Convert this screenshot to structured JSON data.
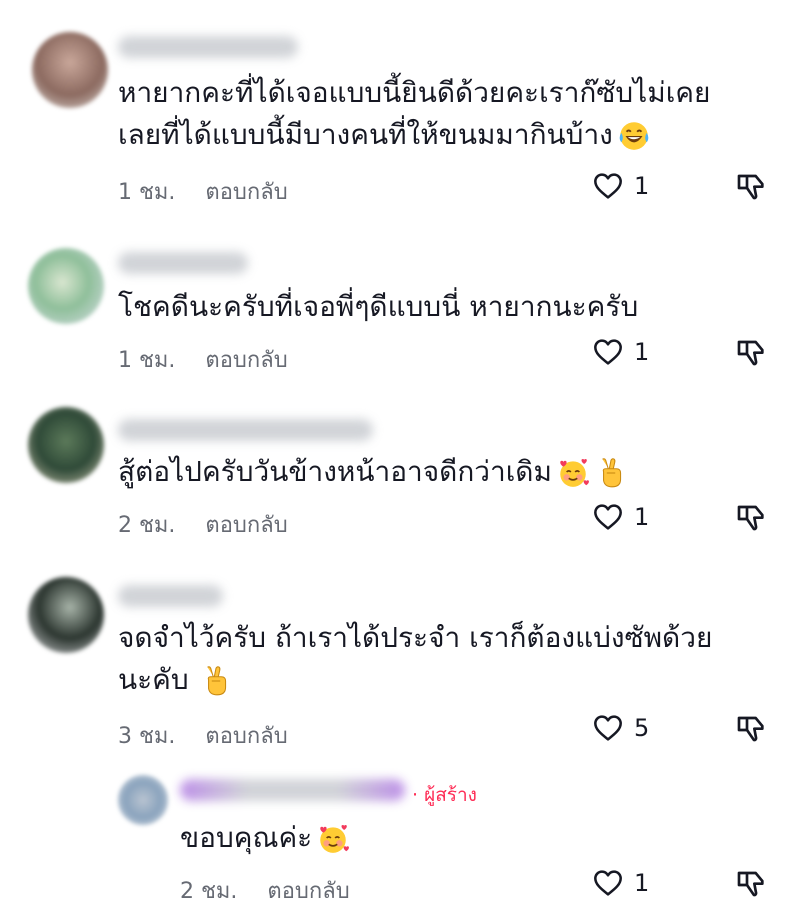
{
  "comments": [
    {
      "text_lines": [
        "หายากคะที่ได้เจอแบบนี้ยินดีด้วยคะเราก๊ซับไม่เคย",
        "เลยที่ได้แบบนี้มีบางคนที่ให้ขนมมากินบ้าง"
      ],
      "time": "1 ชม.",
      "reply": "ตอบกลับ",
      "likes": "1"
    },
    {
      "text_lines": [
        "โชคดีนะครับที่เจอพี่ๆดีแบบนี่ หายากนะครับ"
      ],
      "time": "1 ชม.",
      "reply": "ตอบกลับ",
      "likes": "1"
    },
    {
      "text_lines": [
        "สู้ต่อไปครับวันข้างหน้าอาจดีกว่าเดิม"
      ],
      "time": "2 ชม.",
      "reply": "ตอบกลับ",
      "likes": "1"
    },
    {
      "text_lines": [
        "จดจำไว้ครับ ถ้าเราได้ประจำ เราก็ต้องแบ่งซัพด้วย",
        "นะคับ"
      ],
      "time": "3 ชม.",
      "reply": "ตอบกลับ",
      "likes": "5"
    }
  ],
  "reply": {
    "creator_label": "· ผู้สร้าง",
    "text": "ขอบคุณค่ะ",
    "time": "2 ชม.",
    "reply": "ตอบกลับ",
    "likes": "1"
  },
  "colors": {
    "creator": "#fe2c55",
    "meta": "#666a73",
    "text": "#161823"
  },
  "icons": [
    "heart-outline-icon",
    "dislike-icon",
    "laughing-tears-emoji",
    "smiling-hearts-emoji",
    "victory-hand-emoji"
  ]
}
